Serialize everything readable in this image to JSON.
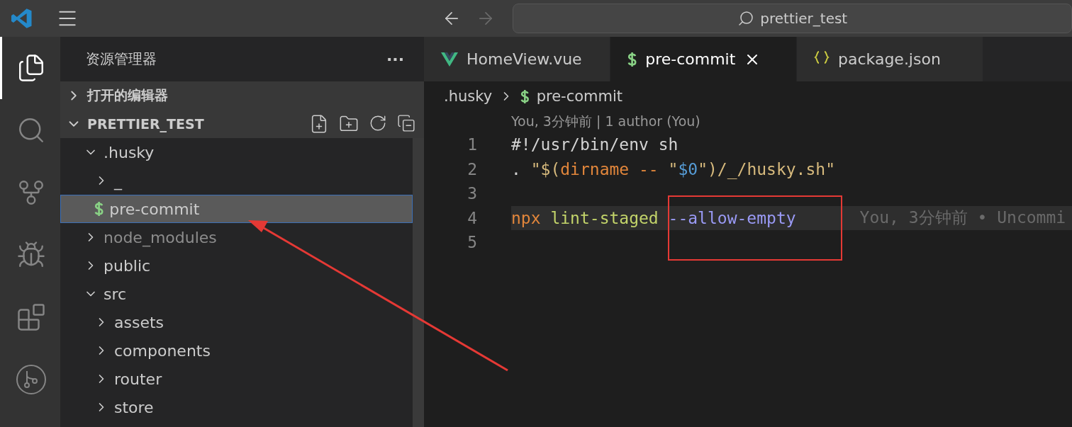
{
  "title_bar": {
    "search": "prettier_test",
    "back_disabled": false,
    "forward_disabled": true
  },
  "activity_bar": {
    "items": [
      {
        "kind": "explorer",
        "selected": true
      },
      {
        "kind": "search",
        "selected": false
      },
      {
        "kind": "source-control",
        "selected": false
      },
      {
        "kind": "run-debug",
        "selected": false
      },
      {
        "kind": "extensions",
        "selected": false
      },
      {
        "kind": "git-graph",
        "selected": false
      }
    ]
  },
  "sidebar": {
    "title": "资源管理器",
    "more": "···",
    "sections": [
      {
        "label": "打开的编辑器",
        "expanded": false
      },
      {
        "label": "PRETTIER_TEST",
        "expanded": true
      }
    ],
    "tree": [
      {
        "label": ".husky",
        "kind": "folder",
        "expanded": true,
        "selected": false,
        "dimmed": false,
        "children": [
          {
            "label": "_",
            "kind": "folder",
            "expanded": false,
            "selected": false,
            "dimmed": false
          },
          {
            "label": "pre-commit",
            "kind": "shell",
            "selected": true,
            "dimmed": false
          }
        ]
      },
      {
        "label": "node_modules",
        "kind": "folder",
        "expanded": false,
        "selected": false,
        "dimmed": true
      },
      {
        "label": "public",
        "kind": "folder",
        "expanded": false,
        "selected": false,
        "dimmed": false
      },
      {
        "label": "src",
        "kind": "folder",
        "expanded": true,
        "selected": false,
        "dimmed": false,
        "children": [
          {
            "label": "assets",
            "kind": "folder",
            "expanded": false,
            "selected": false,
            "dimmed": false
          },
          {
            "label": "components",
            "kind": "folder",
            "expanded": false,
            "selected": false,
            "dimmed": false
          },
          {
            "label": "router",
            "kind": "folder",
            "expanded": false,
            "selected": false,
            "dimmed": false
          },
          {
            "label": "store",
            "kind": "folder",
            "expanded": false,
            "selected": false,
            "dimmed": false
          }
        ]
      }
    ]
  },
  "tabs": [
    {
      "label": "HomeView.vue",
      "kind": "vue",
      "selected": false
    },
    {
      "label": "pre-commit",
      "kind": "shell",
      "selected": true
    },
    {
      "label": "package.json",
      "kind": "json",
      "selected": false
    }
  ],
  "breadcrumb": [
    {
      "label": ".husky",
      "kind": "folder"
    },
    {
      "label": "pre-commit",
      "kind": "shell"
    }
  ],
  "codelens": "You, 3分钟前 | 1 author (You)",
  "lines": [
    {
      "number": "1",
      "highlighted": false,
      "tokens": [
        {
          "text": "#!/usr/bin/env sh",
          "color": "#d4d4d4"
        }
      ]
    },
    {
      "number": "2",
      "highlighted": false,
      "tokens": [
        {
          "text": ". ",
          "color": "#d4d4d4"
        },
        {
          "text": "\"$(",
          "color": "#d7ba7d"
        },
        {
          "text": "dirname -- ",
          "color": "#e2863b"
        },
        {
          "text": "\"",
          "color": "#d7ba7d"
        },
        {
          "text": "$0",
          "color": "#569cd6"
        },
        {
          "text": "\")/_/husky.sh\"",
          "color": "#d7ba7d"
        }
      ]
    },
    {
      "number": "3",
      "highlighted": false
    },
    {
      "number": "4",
      "highlighted": true,
      "blame": "You, 3分钟前 • Uncommi",
      "tokens": [
        {
          "text": "npx",
          "color": "#e2863b"
        },
        {
          "text": " lint-staged ",
          "color": "#c3d46a"
        },
        {
          "text": "--allow-empty",
          "color": "#9a9af5"
        }
      ]
    },
    {
      "number": "5",
      "highlighted": false
    }
  ]
}
